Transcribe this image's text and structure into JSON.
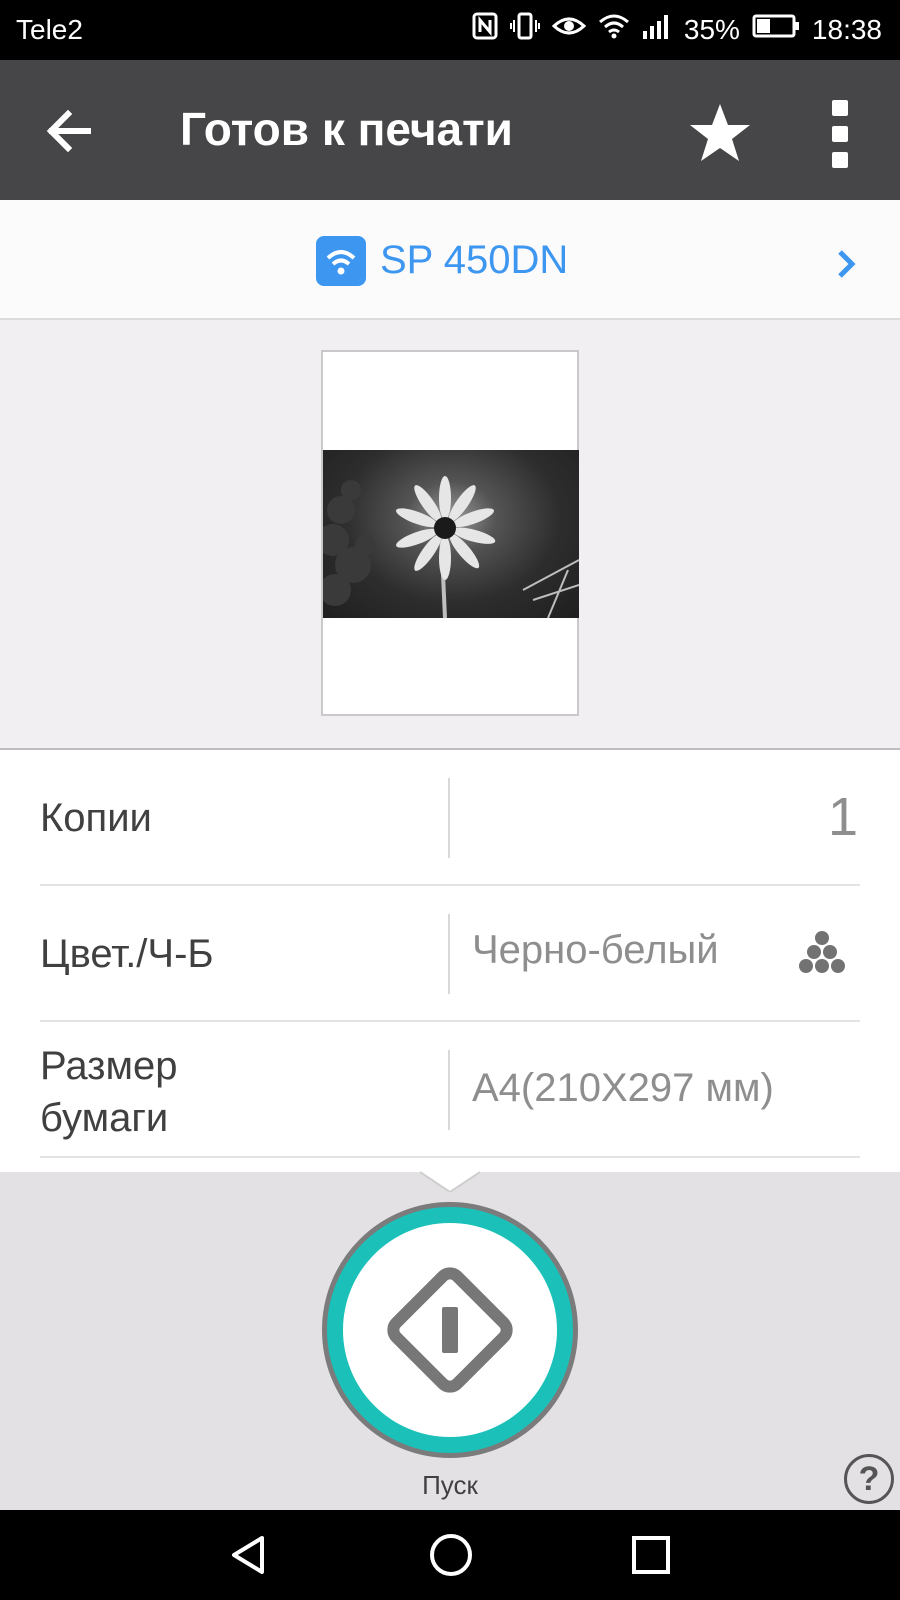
{
  "status_bar": {
    "carrier": "Tele2",
    "battery": "35%",
    "time": "18:38",
    "icons": [
      "nfc-icon",
      "vibrate-icon",
      "eye-icon",
      "wifi-icon",
      "signal-icon",
      "battery-icon"
    ]
  },
  "app_bar": {
    "title": "Готов к печати",
    "icons": [
      "back-arrow-icon",
      "star-icon",
      "more-vert-icon"
    ]
  },
  "printer": {
    "name": "SP 450DN",
    "icon": "wifi-printer-icon",
    "accent_color": "#3d96f0"
  },
  "settings": {
    "copies": {
      "label": "Копии",
      "value": "1"
    },
    "color_mode": {
      "label": "Цвет./Ч-Б",
      "value": "Черно-белый",
      "icon": "toner-dots-icon"
    },
    "paper_size": {
      "label_line1": "Размер",
      "label_line2": "бумаги",
      "value": "A4(210X297 мм)"
    }
  },
  "start": {
    "label": "Пуск",
    "ring_color": "#1bc1b9"
  },
  "help": {
    "glyph": "?"
  },
  "nav": {
    "icons": [
      "back-triangle-icon",
      "home-circle-icon",
      "recents-square-icon"
    ]
  }
}
